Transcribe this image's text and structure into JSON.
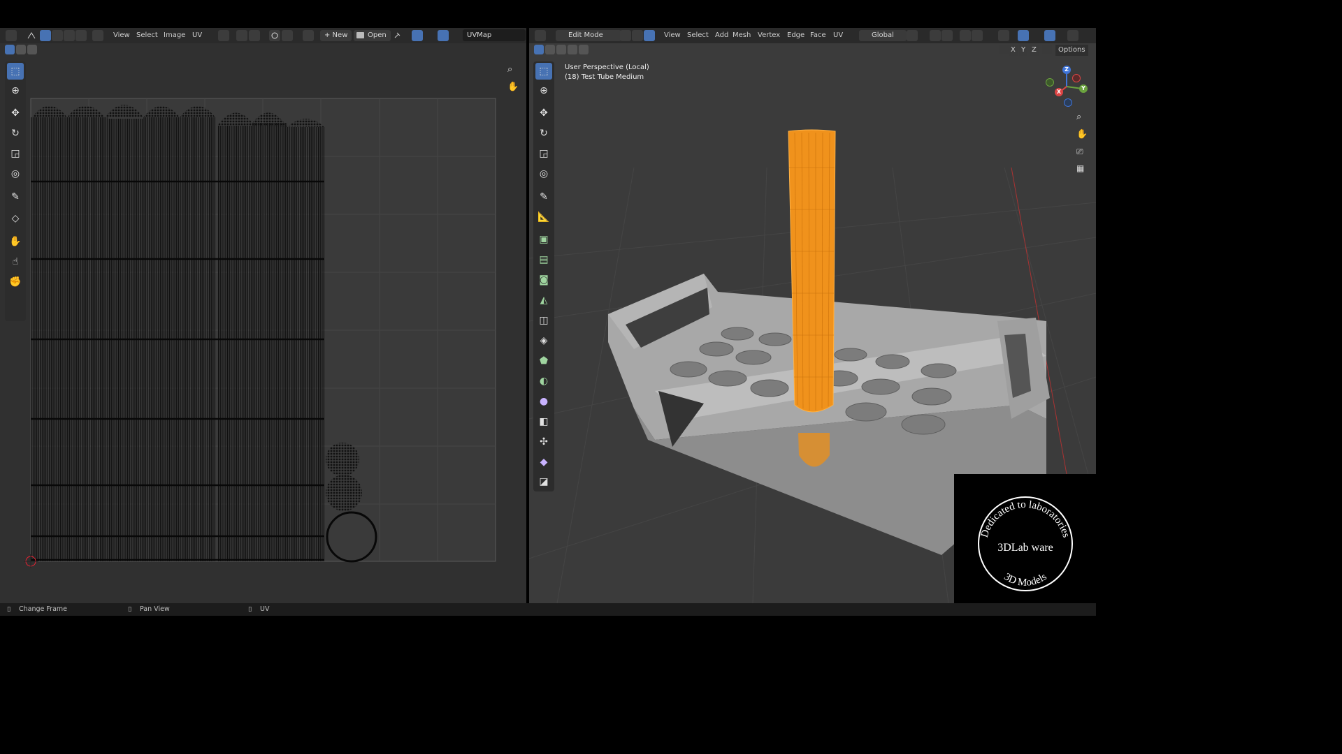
{
  "uv_editor": {
    "menu": {
      "view": "View",
      "select": "Select",
      "image": "Image",
      "uv": "UV"
    },
    "new_label": "+ New",
    "open_label": "Open",
    "uv_map": "UVMap",
    "tools": [
      "select-box",
      "cursor",
      "move",
      "rotate",
      "scale",
      "transform",
      "annotate",
      "rip",
      "grab",
      "relax",
      "pinch"
    ]
  },
  "viewport": {
    "mode": "Edit Mode",
    "menu": {
      "view": "View",
      "select": "Select",
      "add": "Add",
      "mesh": "Mesh",
      "vertex": "Vertex",
      "edge": "Edge",
      "face": "Face",
      "uv": "UV"
    },
    "orientation": "Global",
    "axes": {
      "x": "X",
      "y": "Y",
      "z": "Z"
    },
    "options": "Options",
    "overlay_line1": "User Perspective (Local)",
    "overlay_line2": "(18) Test Tube Medium",
    "gizmo": {
      "x": "X",
      "y": "Y",
      "z": "Z"
    }
  },
  "status_bar": {
    "item1": "Change Frame",
    "item2": "Pan View",
    "item3": "UV"
  },
  "watermark": {
    "arc_top": "Dedicated to laboratories",
    "center": "3DLab ware",
    "arc_bottom": "3D Models"
  },
  "colors": {
    "accent": "#4772b3",
    "selection": "#f0921c",
    "mesh": "#9b9b9b"
  }
}
